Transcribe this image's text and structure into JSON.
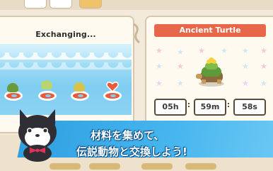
{
  "exchange": {
    "title": "Exchanging...",
    "queue_creatures": [
      "turtle",
      "green-plant-creature",
      "yellow-flower-creature",
      "heart"
    ]
  },
  "reward": {
    "title": "Ancient Turtle",
    "timer": {
      "hours": "05h",
      "minutes": "59m",
      "seconds": "58s"
    }
  },
  "promo": {
    "line1": "材料を集めて、",
    "line2": "伝説動物と交換しよう!"
  },
  "colors": {
    "banner": "#e8664a",
    "sea": "#7fcdf1",
    "caption_band": "#2f9fe0",
    "ring": "#e85a3a"
  }
}
